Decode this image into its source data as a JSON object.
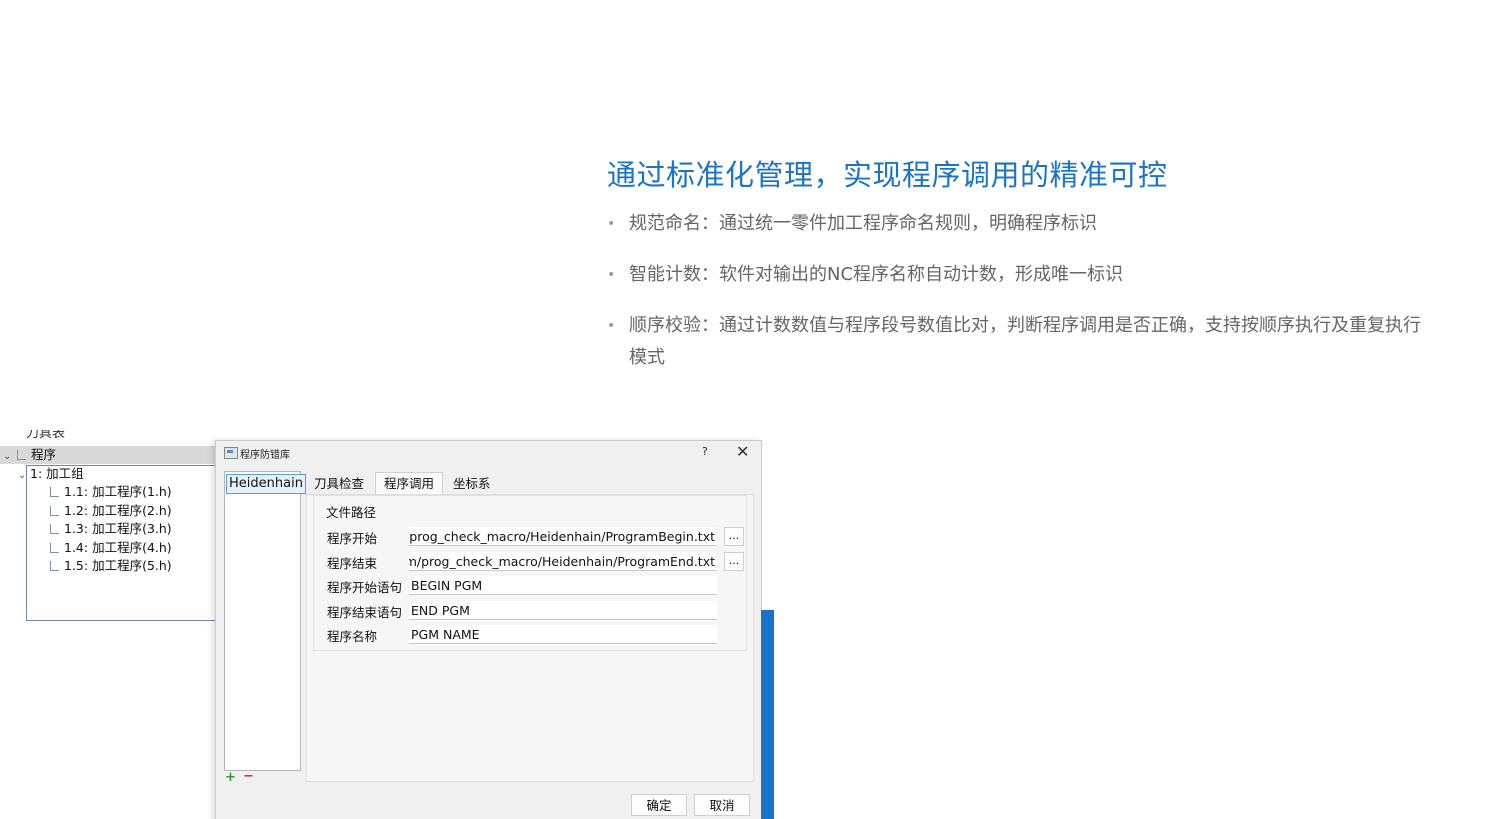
{
  "headline": "通过标准化管理，实现程序调用的精准可控",
  "bullets": [
    "规范命名：通过统一零件加工程序命名规则，明确程序标识",
    "智能计数：软件对输出的NC程序名称自动计数，形成唯一标识",
    "顺序校验：通过计数数值与程序段号数值比对，判断程序调用是否正确，支持按顺序执行及重复执行模式"
  ],
  "tree": {
    "cut_label": "刀具表",
    "root": "程序",
    "group": "1: 加工组",
    "items": [
      "1.1: 加工程序(1.h)",
      "1.2: 加工程序(2.h)",
      "1.3: 加工程序(3.h)",
      "1.4: 加工程序(4.h)",
      "1.5: 加工程序(5.h)"
    ]
  },
  "dialog": {
    "title": "程序防错库",
    "help": "?",
    "close": "✕",
    "list_items": [
      "Heidenhain"
    ],
    "add": "+",
    "remove": "−",
    "tabs": [
      "刀具检查",
      "程序调用",
      "坐标系"
    ],
    "active_tab": "程序调用",
    "group_title": "文件路径",
    "fields": [
      {
        "label": "程序开始",
        "value": "/prog_check_macro/Heidenhain/ProgramBegin.txt",
        "browse": "..."
      },
      {
        "label": "程序结束",
        "value": "am/prog_check_macro/Heidenhain/ProgramEnd.txt",
        "browse": "..."
      },
      {
        "label": "程序开始语句",
        "value": "BEGIN PGM"
      },
      {
        "label": "程序结束语句",
        "value": "END PGM"
      },
      {
        "label": "程序名称",
        "value": "PGM NAME"
      }
    ],
    "ok": "确定",
    "cancel": "取消"
  },
  "colors": {
    "accent_blue": "#1d74c4",
    "side_bar_blue": "#1a73c9"
  }
}
